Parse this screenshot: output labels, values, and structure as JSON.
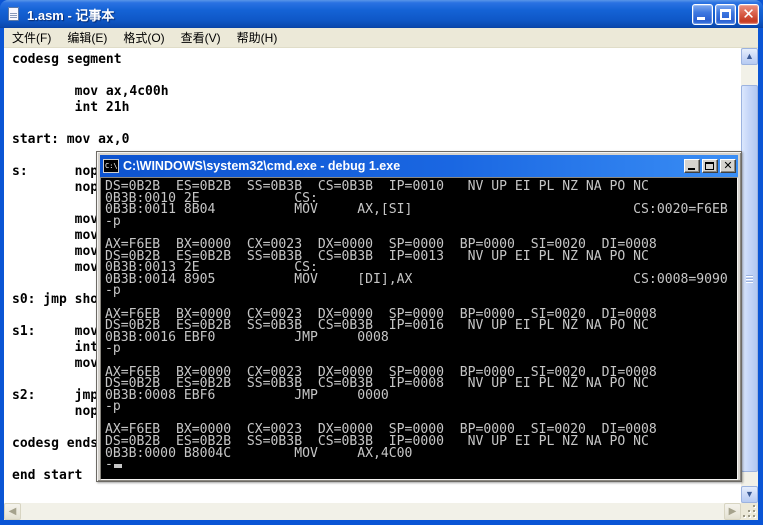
{
  "notepad": {
    "title": "1.asm - 记事本",
    "menu": [
      "文件(F)",
      "编辑(E)",
      "格式(O)",
      "查看(V)",
      "帮助(H)"
    ],
    "editor_lines": [
      "codesg segment",
      "",
      "        mov ax,4c00h",
      "        int 21h",
      "",
      "start: mov ax,0",
      "",
      "s:      nop",
      "        nop",
      "",
      "        mov",
      "        mov",
      "        mov",
      "        mov",
      "",
      "s0: jmp sho",
      "",
      "s1:     mov",
      "        int",
      "        mov",
      "",
      "s2:     jmp",
      "        nop",
      "",
      "codesg ends",
      "",
      "end start"
    ]
  },
  "cmd": {
    "title": "C:\\WINDOWS\\system32\\cmd.exe - debug 1.exe",
    "icon_text": "C:\\",
    "console_lines": [
      "DS=0B2B  ES=0B2B  SS=0B3B  CS=0B3B  IP=0010   NV UP EI PL NZ NA PO NC",
      "0B3B:0010 2E            CS:",
      "0B3B:0011 8B04          MOV     AX,[SI]                            CS:0020=F6EB",
      "-p",
      "",
      "AX=F6EB  BX=0000  CX=0023  DX=0000  SP=0000  BP=0000  SI=0020  DI=0008",
      "DS=0B2B  ES=0B2B  SS=0B3B  CS=0B3B  IP=0013   NV UP EI PL NZ NA PO NC",
      "0B3B:0013 2E            CS:",
      "0B3B:0014 8905          MOV     [DI],AX                            CS:0008=9090",
      "-p",
      "",
      "AX=F6EB  BX=0000  CX=0023  DX=0000  SP=0000  BP=0000  SI=0020  DI=0008",
      "DS=0B2B  ES=0B2B  SS=0B3B  CS=0B3B  IP=0016   NV UP EI PL NZ NA PO NC",
      "0B3B:0016 EBF0          JMP     0008",
      "-p",
      "",
      "AX=F6EB  BX=0000  CX=0023  DX=0000  SP=0000  BP=0000  SI=0020  DI=0008",
      "DS=0B2B  ES=0B2B  SS=0B3B  CS=0B3B  IP=0008   NV UP EI PL NZ NA PO NC",
      "0B3B:0008 EBF6          JMP     0000",
      "-p",
      "",
      "AX=F6EB  BX=0000  CX=0023  DX=0000  SP=0000  BP=0000  SI=0020  DI=0008",
      "DS=0B2B  ES=0B2B  SS=0B3B  CS=0B3B  IP=0000   NV UP EI PL NZ NA PO NC",
      "0B3B:0000 B8004C        MOV     AX,4C00"
    ],
    "prompt": "-"
  },
  "colors": {
    "luna_titlebar": "#1563d6",
    "luna_border": "#0a55d5",
    "close_button_red": "#d9604a",
    "menu_bg": "#ece9d8",
    "cmd_titlebar_left": "#0d53cf",
    "cmd_titlebar_right": "#3a8ef5",
    "console_bg": "#000000",
    "console_text": "#c6c6c6"
  }
}
